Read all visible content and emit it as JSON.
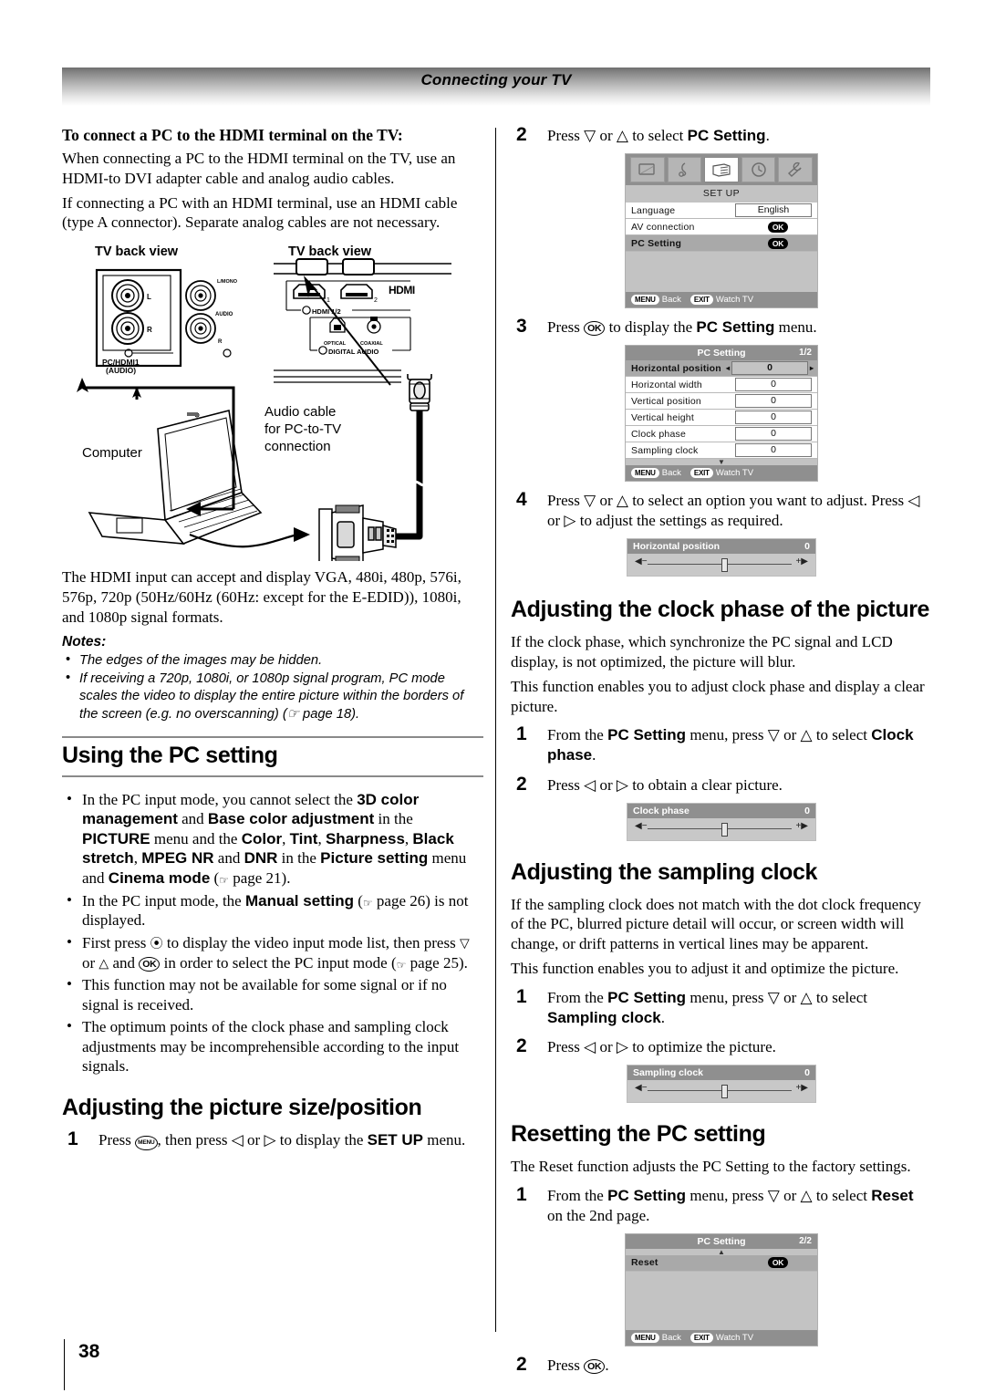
{
  "header": {
    "title": "Connecting your TV"
  },
  "page_number": "38",
  "left": {
    "subhead": "To connect a PC to the HDMI terminal on the TV:",
    "para1": "When connecting a PC to the HDMI terminal on the TV, use an HDMI-to DVI adapter cable and analog audio cables.",
    "para2": "If connecting a PC with an HDMI terminal, use an HDMI cable (type A connector). Separate analog cables are not necessary.",
    "diagram": {
      "tv_back_view_1": "TV back view",
      "tv_back_view_2": "TV back view",
      "jack_label_1": "PC/HDMI1",
      "jack_label_2": "(AUDIO)",
      "jack_l": "L",
      "jack_r": "R",
      "jack_group_1": "L/MONO",
      "jack_group_2": "AUDIO",
      "jack_group_r": "R",
      "hdmi_label": "HDMI",
      "hdmi_port_1": "1",
      "hdmi_port_2": "2",
      "hdmi_group": "HDMI 1/2",
      "optical": "OPTICAL",
      "coaxial": "COAXIAL",
      "digital_audio": "DIGITAL AUDIO",
      "computer": "Computer",
      "audio_cable_line1": "Audio cable",
      "audio_cable_line2": "for PC-to-TV",
      "audio_cable_line3": "connection"
    },
    "para3": "The HDMI input can accept and display VGA, 480i, 480p, 576i, 576p, 720p (50Hz/60Hz (60Hz: except for the E-EDID)), 1080i, and 1080p signal formats.",
    "notes_title": "Notes:",
    "notes": [
      "The edges of the images may be hidden.",
      "If receiving a 720p, 1080i, or 1080p signal program, PC mode scales the video to display the entire picture within the borders of the screen (e.g. no overscanning) (☞ page 18)."
    ],
    "heading_using": "Using the PC setting",
    "bullets": [
      "In the PC input mode, you cannot select the 3D color management and Base color adjustment in the PICTURE menu and the Color, Tint, Sharpness, Black stretch, MPEG NR and DNR in the Picture setting menu and Cinema mode (☞ page 21).",
      "In the PC input mode, the Manual setting (☞ page 26) is not displayed.",
      "First press ⦿ to display the video input mode list, then press ▽ or △ and OK in order to select the PC input mode (☞ page 25).",
      "This function may not be available for some signal or if no signal is received.",
      "The optimum points of the clock phase and sampling clock adjustments may be incomprehensible according to the input signals."
    ],
    "heading_picture_size": "Adjusting the picture size/position",
    "step1_num": "1",
    "step1_text_a": "Press ",
    "step1_key": "MENU",
    "step1_text_b": ", then press ◁ or ▷ to display the ",
    "step1_bold": "SET UP",
    "step1_text_c": " menu."
  },
  "right": {
    "step2_num": "2",
    "step2_text_a": "Press ▽ or △ to select ",
    "step2_bold": "PC Setting",
    "step2_text_b": ".",
    "setup_menu": {
      "title": "SET UP",
      "icons": [
        "picture-icon",
        "audio-icon",
        "setup-icon",
        "timer-icon",
        "tools-icon"
      ],
      "rows": [
        {
          "label": "Language",
          "value": "English",
          "type": "box",
          "selected": false
        },
        {
          "label": "AV connection",
          "value": "OK",
          "type": "ok",
          "selected": false
        },
        {
          "label": "PC Setting",
          "value": "OK",
          "type": "ok",
          "selected": true
        }
      ],
      "footer_menu_key": "MENU",
      "footer_menu_label": "Back",
      "footer_exit_key": "EXIT",
      "footer_exit_label": "Watch TV"
    },
    "step3_num": "3",
    "step3_text_a": "Press ",
    "step3_key": "OK",
    "step3_text_b": " to display the ",
    "step3_bold": "PC Setting",
    "step3_text_c": " menu.",
    "pc_setting_menu": {
      "title": "PC Setting",
      "page": "1/2",
      "rows": [
        {
          "label": "Horizontal position",
          "value": "0",
          "selected": true
        },
        {
          "label": "Horizontal width",
          "value": "0",
          "selected": false
        },
        {
          "label": "Vertical position",
          "value": "0",
          "selected": false
        },
        {
          "label": "Vertical height",
          "value": "0",
          "selected": false
        },
        {
          "label": "Clock phase",
          "value": "0",
          "selected": false
        },
        {
          "label": "Sampling clock",
          "value": "0",
          "selected": false
        }
      ],
      "footer_menu_key": "MENU",
      "footer_menu_label": "Back",
      "footer_exit_key": "EXIT",
      "footer_exit_label": "Watch TV"
    },
    "step4_num": "4",
    "step4_text": "Press ▽ or △ to select an option you want to adjust. Press ◁ or ▷ to adjust the settings as required.",
    "slider_horizontal": {
      "label": "Horizontal position",
      "value": "0",
      "left_mark": "◀−",
      "right_mark": "+▶"
    },
    "heading_clock_phase": "Adjusting the clock phase of the picture",
    "clock_para1": "If the clock phase, which synchronize the PC signal and LCD display, is not optimized, the picture will blur.",
    "clock_para2": "This function enables you to adjust clock phase and display a clear picture.",
    "clock_step1_num": "1",
    "clock_step1_a": "From the ",
    "clock_step1_bold1": "PC Setting",
    "clock_step1_b": " menu, press ▽ or △ to select ",
    "clock_step1_bold2": "Clock phase",
    "clock_step1_c": ".",
    "clock_step2_num": "2",
    "clock_step2_text": "Press ◁ or ▷ to obtain a clear picture.",
    "slider_clock": {
      "label": "Clock phase",
      "value": "0",
      "left_mark": "◀−",
      "right_mark": "+▶"
    },
    "heading_sampling": "Adjusting the sampling clock",
    "sampling_para1": "If the sampling clock does not match with the dot clock frequency of the PC, blurred picture detail will occur, or screen width will change, or drift patterns in vertical lines may be apparent.",
    "sampling_para2": "This function enables you to adjust it and optimize the picture.",
    "sampling_step1_num": "1",
    "sampling_step1_a": "From the ",
    "sampling_step1_bold1": "PC Setting",
    "sampling_step1_b": " menu, press ▽ or △ to select ",
    "sampling_step1_bold2": "Sampling clock",
    "sampling_step1_c": ".",
    "sampling_step2_num": "2",
    "sampling_step2_text": "Press ◁ or ▷ to optimize the picture.",
    "slider_sampling": {
      "label": "Sampling clock",
      "value": "0",
      "left_mark": "◀−",
      "right_mark": "+▶"
    },
    "heading_reset": "Resetting the PC setting",
    "reset_para": "The Reset function adjusts the PC Setting to the factory settings.",
    "reset_step1_num": "1",
    "reset_step1_a": "From the ",
    "reset_step1_bold1": "PC Setting",
    "reset_step1_b": " menu, press ▽ or △ to select ",
    "reset_step1_bold2": "Reset",
    "reset_step1_c": " on the 2nd page.",
    "reset_menu": {
      "title": "PC Setting",
      "page": "2/2",
      "rows": [
        {
          "label": "Reset",
          "value": "OK",
          "selected": true
        }
      ],
      "footer_menu_key": "MENU",
      "footer_menu_label": "Back",
      "footer_exit_key": "EXIT",
      "footer_exit_label": "Watch TV"
    },
    "reset_step2_num": "2",
    "reset_step2_a": "Press ",
    "reset_step2_key": "OK",
    "reset_step2_b": "."
  }
}
